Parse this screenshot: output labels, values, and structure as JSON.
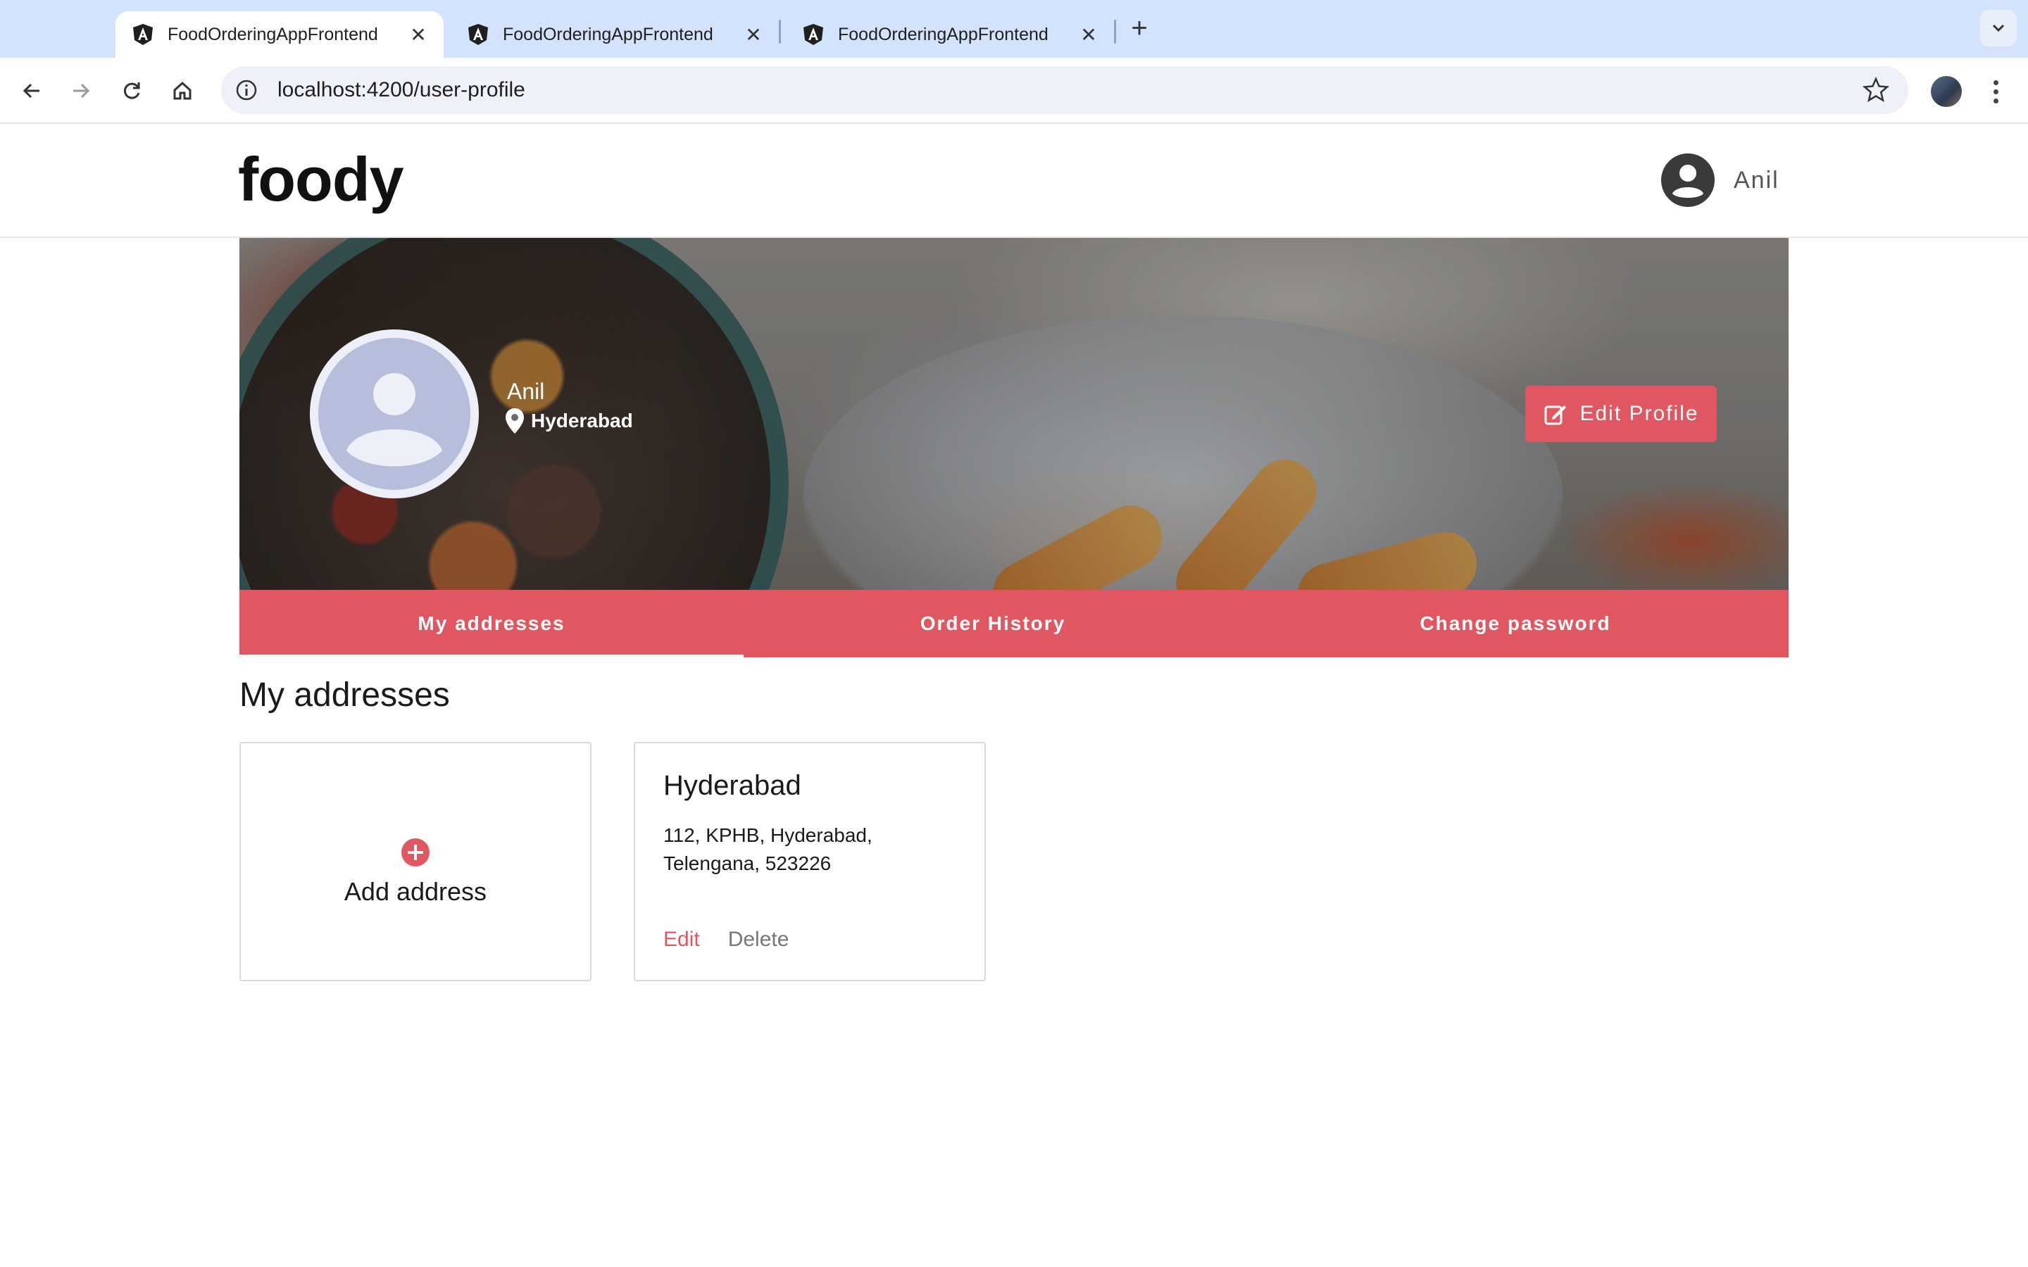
{
  "browser": {
    "tabs": [
      {
        "title": "FoodOrderingAppFrontend",
        "active": true
      },
      {
        "title": "FoodOrderingAppFrontend",
        "active": false
      },
      {
        "title": "FoodOrderingAppFrontend",
        "active": false
      }
    ],
    "url": "localhost:4200/user-profile",
    "icons": {
      "back": "arrow-left-icon",
      "forward": "arrow-right-icon",
      "reload": "reload-icon",
      "home": "home-icon",
      "site_info": "info-icon",
      "bookmark": "star-icon",
      "menu": "kebab-icon"
    }
  },
  "header": {
    "brand": "foody",
    "user_name": "Anil"
  },
  "profile": {
    "name": "Anil",
    "location": "Hyderabad",
    "edit_button": "Edit Profile"
  },
  "tabs": {
    "items": [
      {
        "label": "My addresses",
        "active": true
      },
      {
        "label": "Order History",
        "active": false
      },
      {
        "label": "Change password",
        "active": false
      }
    ]
  },
  "addresses": {
    "section_title": "My addresses",
    "add_label": "Add address",
    "items": [
      {
        "title": "Hyderabad",
        "body": "112, KPHB, Hyderabad, Telengana, 523226",
        "edit_label": "Edit",
        "delete_label": "Delete"
      }
    ]
  },
  "colors": {
    "accent": "#e05762",
    "tabbar_bg": "#d3e3fd",
    "avatar_bg": "#b6bedb"
  }
}
